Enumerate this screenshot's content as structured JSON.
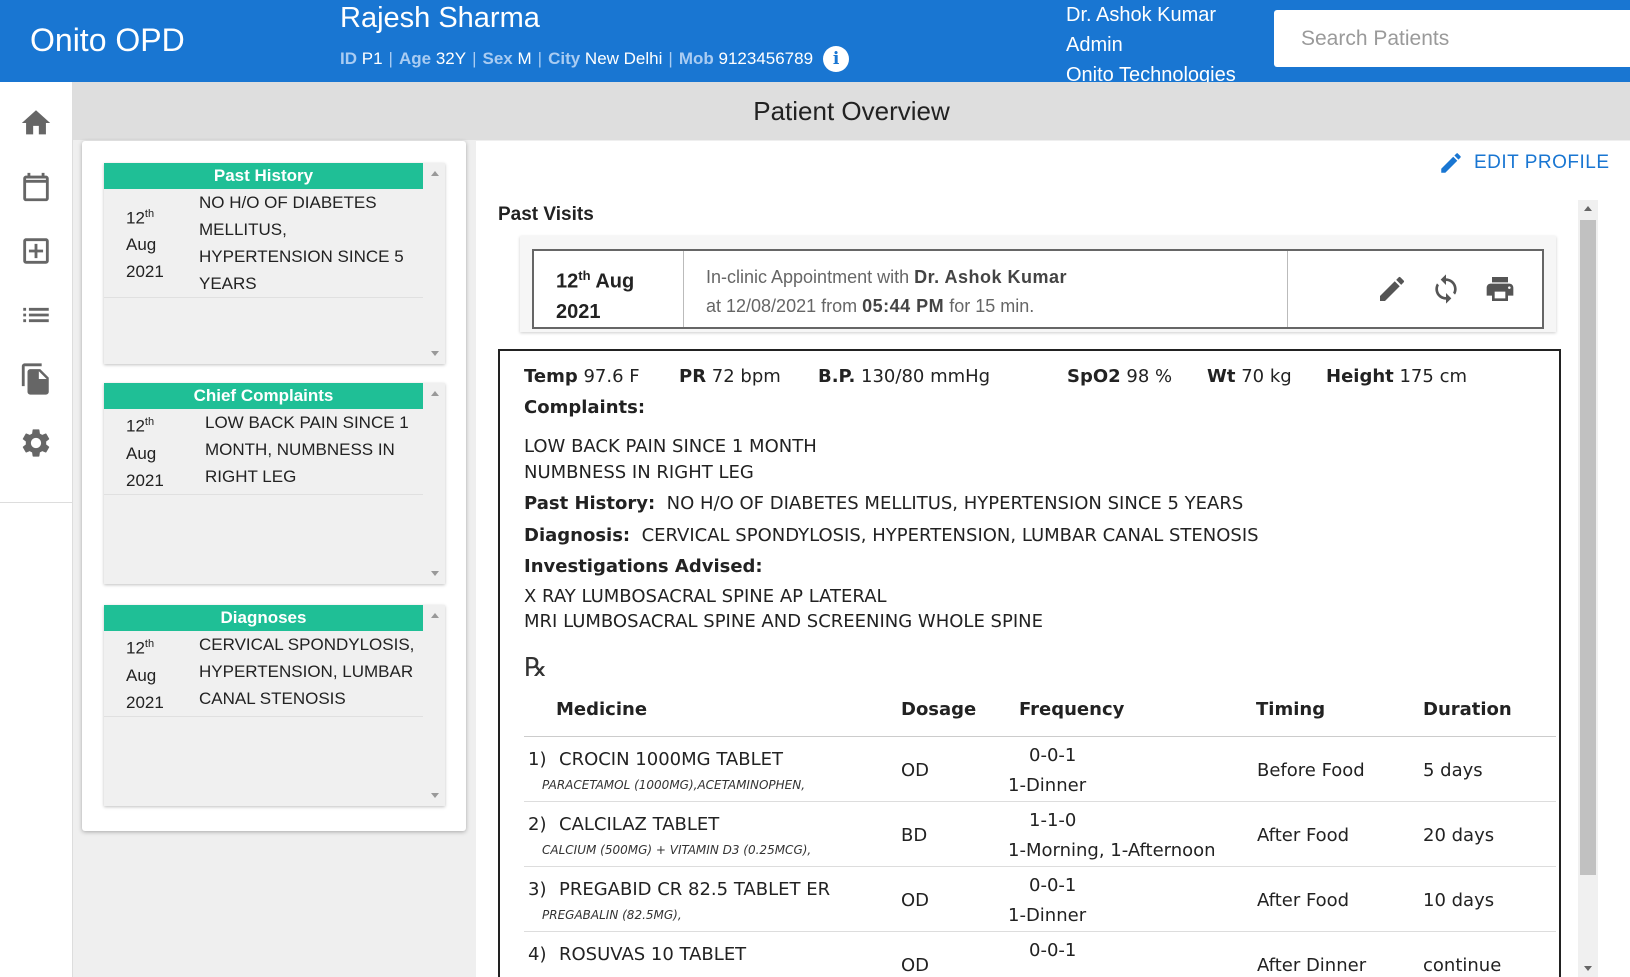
{
  "app": {
    "title": "Onito OPD"
  },
  "patient": {
    "name": "Rajesh Sharma",
    "id_label": "ID",
    "id": "P1",
    "age_label": "Age",
    "age": "32Y",
    "sex_label": "Sex",
    "sex": "M",
    "city_label": "City",
    "city": "New Delhi",
    "mob_label": "Mob",
    "mob": "9123456789",
    "separator": "|",
    "info_icon": "i"
  },
  "user": {
    "name": "Dr. Ashok Kumar",
    "role": "Admin",
    "org": "Onito Technologies"
  },
  "search": {
    "placeholder": "Search Patients",
    "value": ""
  },
  "sidebar": {
    "icons": [
      "home-icon",
      "calendar-icon",
      "add-box-icon",
      "list-icon",
      "copy-icon",
      "gear-icon"
    ]
  },
  "page": {
    "title": "Patient Overview"
  },
  "summary_cards": [
    {
      "title": "Past History",
      "day": "12",
      "suffix": "th",
      "month": "Aug",
      "year": "2021",
      "text": "NO H/O OF DIABETES MELLITUS, HYPERTENSION SINCE 5 YEARS"
    },
    {
      "title": "Chief Complaints",
      "day": "12",
      "suffix": "th",
      "month": "Aug",
      "year": "2021",
      "text": "LOW BACK PAIN SINCE 1 MONTH, NUMBNESS IN RIGHT LEG"
    },
    {
      "title": "Diagnoses",
      "day": "12",
      "suffix": "th",
      "month": "Aug",
      "year": "2021",
      "text": "CERVICAL SPONDYLOSIS, HYPERTENSION, LUMBAR CANAL STENOSIS"
    }
  ],
  "edit_profile": {
    "label": "EDIT PROFILE"
  },
  "past_visits": {
    "label": "Past Visits",
    "visit": {
      "day": "12",
      "suffix": "th",
      "month": "Aug",
      "year": "2021",
      "line1_prefix": "In-clinic Appointment with",
      "doctor": "Dr. Ashok Kumar",
      "line2_prefix": "at 12/08/2021 from",
      "time": "05:44 PM",
      "line2_suffix": "for 15 min."
    }
  },
  "visit_detail": {
    "vitals": [
      {
        "label": "Temp",
        "value": "97.6 F"
      },
      {
        "label": "PR",
        "value": "72 bpm"
      },
      {
        "label": "B.P.",
        "value": "130/80 mmHg"
      },
      {
        "label": "SpO2",
        "value": "98 %"
      },
      {
        "label": "Wt",
        "value": "70 kg"
      },
      {
        "label": "Height",
        "value": "175 cm"
      }
    ],
    "complaints_label": "Complaints:",
    "complaints": [
      "LOW BACK PAIN SINCE 1 MONTH",
      "NUMBNESS IN RIGHT LEG"
    ],
    "past_history_label": "Past History:",
    "past_history": "NO H/O OF DIABETES MELLITUS, HYPERTENSION SINCE 5 YEARS",
    "diagnosis_label": "Diagnosis:",
    "diagnosis": "CERVICAL SPONDYLOSIS, HYPERTENSION, LUMBAR CANAL STENOSIS",
    "investigations_label": "Investigations Advised:",
    "investigations": [
      "X RAY LUMBOSACRAL SPINE AP LATERAL",
      "MRI LUMBOSACRAL SPINE AND SCREENING WHOLE SPINE"
    ],
    "rx_symbol": "℞",
    "med_columns": {
      "medicine": "Medicine",
      "dosage": "Dosage",
      "frequency": "Frequency",
      "timing": "Timing",
      "duration": "Duration"
    },
    "medicines": [
      {
        "num": "1)",
        "name": "CROCIN 1000MG TABLET",
        "composition": "PARACETAMOL (1000MG),ACETAMINOPHEN,",
        "dosage": "OD",
        "freq": "0-0-1",
        "freq_detail": "1-Dinner",
        "timing": "Before Food",
        "duration": "5 days"
      },
      {
        "num": "2)",
        "name": "CALCILAZ TABLET",
        "composition": "CALCIUM (500MG) + VITAMIN D3 (0.25MCG),",
        "dosage": "BD",
        "freq": "1-1-0",
        "freq_detail": "1-Morning, 1-Afternoon",
        "timing": "After Food",
        "duration": "20 days"
      },
      {
        "num": "3)",
        "name": "PREGABID CR 82.5 TABLET ER",
        "composition": "PREGABALIN (82.5MG),",
        "dosage": "OD",
        "freq": "0-0-1",
        "freq_detail": "1-Dinner",
        "timing": "After Food",
        "duration": "10 days"
      },
      {
        "num": "4)",
        "name": "ROSUVAS 10 TABLET",
        "composition": "",
        "dosage": "OD",
        "freq": "0-0-1",
        "freq_detail": "",
        "timing": "After Dinner",
        "duration": "continue"
      }
    ]
  },
  "colors": {
    "primary": "#1976d2",
    "accent": "#1fbf96"
  }
}
